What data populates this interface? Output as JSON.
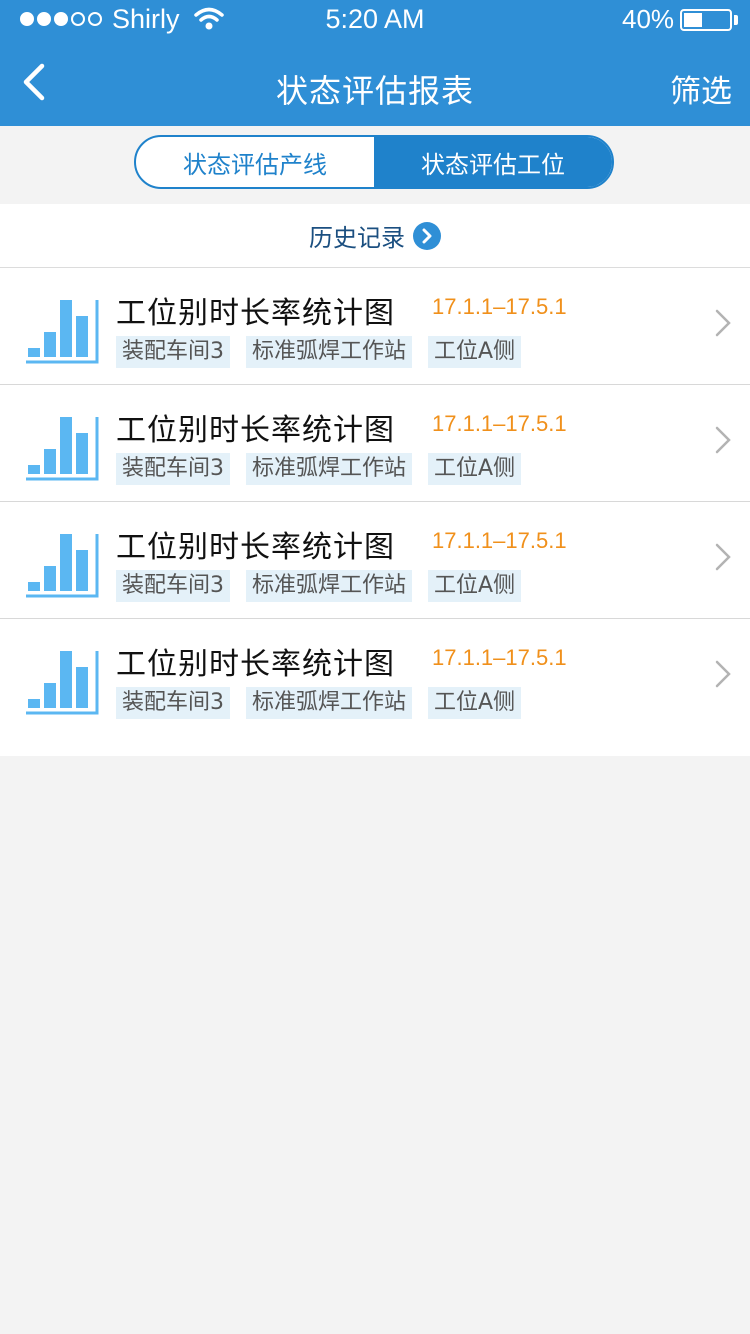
{
  "status": {
    "carrier": "Shirly",
    "time": "5:20 AM",
    "battery": "40%",
    "battery_level": 0.4,
    "signal_bars_filled": 3,
    "signal_bars_total": 5
  },
  "nav": {
    "title": "状态评估报表",
    "filter_label": "筛选"
  },
  "segment": {
    "options": [
      "状态评估产线",
      "状态评估工位"
    ],
    "selected_index": 1
  },
  "history": {
    "label": "历史记录"
  },
  "colors": {
    "primary": "#2f8fd6",
    "accent": "#f0901b",
    "icon": "#5bb7f2"
  },
  "items": [
    {
      "title": "工位别时长率统计图",
      "date": "17.1.1–17.5.1",
      "tags": [
        "装配车间3",
        "标准弧焊工作站",
        "工位A侧"
      ]
    },
    {
      "title": "工位别时长率统计图",
      "date": "17.1.1–17.5.1",
      "tags": [
        "装配车间3",
        "标准弧焊工作站",
        "工位A侧"
      ]
    },
    {
      "title": "工位别时长率统计图",
      "date": "17.1.1–17.5.1",
      "tags": [
        "装配车间3",
        "标准弧焊工作站",
        "工位A侧"
      ]
    },
    {
      "title": "工位别时长率统计图",
      "date": "17.1.1–17.5.1",
      "tags": [
        "装配车间3",
        "标准弧焊工作站",
        "工位A侧"
      ]
    }
  ]
}
